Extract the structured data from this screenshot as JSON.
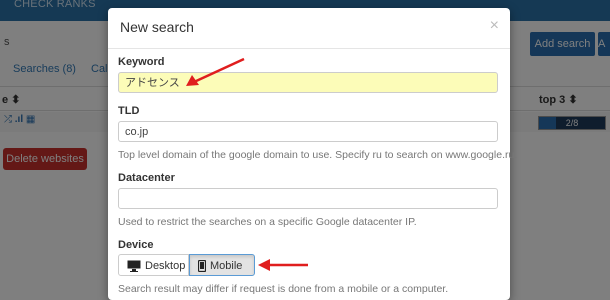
{
  "background": {
    "brand": "CHECK RANKS",
    "tabs": [
      "Searches (8)",
      "Cale"
    ],
    "add_search_label": "Add search",
    "add_second_label": "A",
    "table_header_left": "e ⬍",
    "table_header_top3": "top 3 ⬍",
    "progress_label": "2/8",
    "progress_fraction": 0.25,
    "delete_label": "Delete websites"
  },
  "modal": {
    "title": "New search",
    "close_symbol": "×",
    "keyword": {
      "label": "Keyword",
      "value": "アドセンス"
    },
    "tld": {
      "label": "TLD",
      "value": "co.jp",
      "help": "Top level domain of the google domain to use. Specify ru to search on www.google.ru."
    },
    "datacenter": {
      "label": "Datacenter",
      "value": "",
      "help": "Used to restrict the searches on a specific Google datacenter IP."
    },
    "device": {
      "label": "Device",
      "options": [
        "Desktop",
        "Mobile"
      ],
      "selected": "Mobile",
      "help": "Search result may differ if request is done from a mobile or a computer."
    }
  },
  "colors": {
    "accent": "#2a6fb0",
    "danger": "#c9302c",
    "highlight": "#fcfcb8",
    "annotation": "#e01e1e"
  }
}
